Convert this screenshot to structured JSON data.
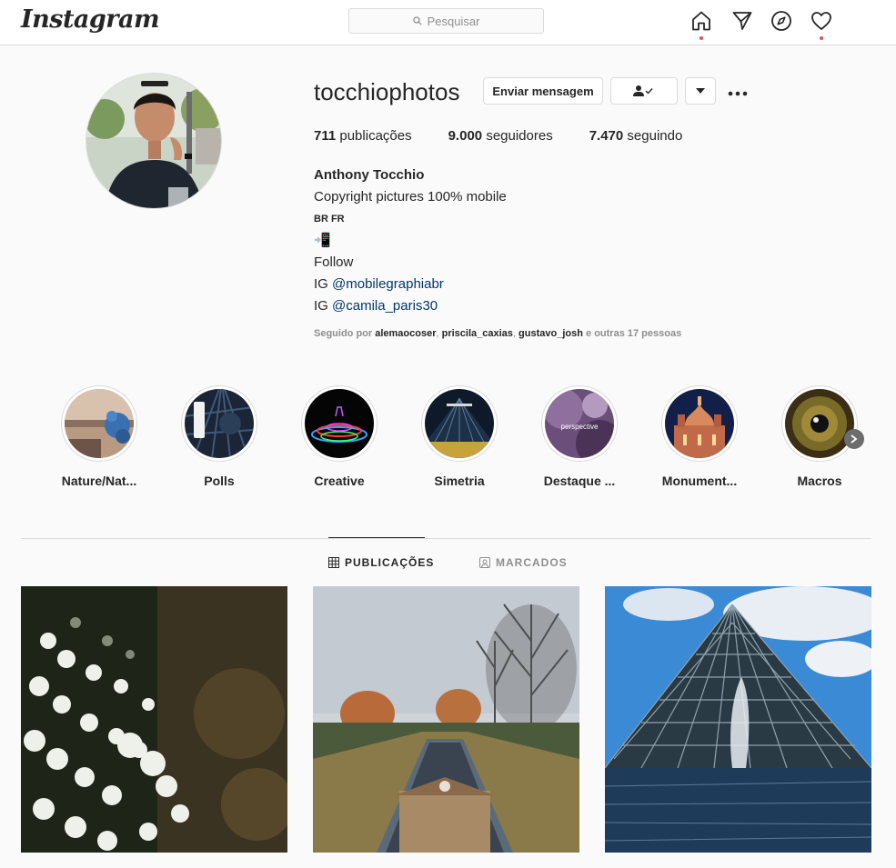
{
  "topbar": {
    "logo": "Instagram",
    "search_placeholder": "Pesquisar"
  },
  "profile": {
    "username": "tocchiophotos",
    "message_button": "Enviar mensagem",
    "stats": [
      {
        "count": "711",
        "label": "publicações"
      },
      {
        "count": "9.000",
        "label": "seguidores"
      },
      {
        "count": "7.470",
        "label": "seguindo"
      }
    ],
    "full_name": "Anthony Tocchio",
    "bio_line1": "Copyright pictures 100% mobile",
    "bio_flags": "BR FR",
    "bio_emoji": "📲",
    "bio_follow": "Follow",
    "bio_ig_prefix": "IG",
    "bio_link1": "@mobilegraphiabr",
    "bio_link2": "@camila_paris30",
    "followed_prefix": "Seguido por",
    "followed_users": [
      "alemaocoser",
      "priscila_caxias",
      "gustavo_josh"
    ],
    "followed_suffix": "e outras 17 pessoas"
  },
  "highlights": [
    {
      "label": "Nature/Nat..."
    },
    {
      "label": "Polls"
    },
    {
      "label": "Creative"
    },
    {
      "label": "Simetria"
    },
    {
      "label": "Destaque ..."
    },
    {
      "label": "Monument..."
    },
    {
      "label": "Macros"
    }
  ],
  "highlight_perspective_text": "perspective",
  "tabs": {
    "posts": "PUBLICAÇÕES",
    "tagged": "MARCADOS"
  }
}
